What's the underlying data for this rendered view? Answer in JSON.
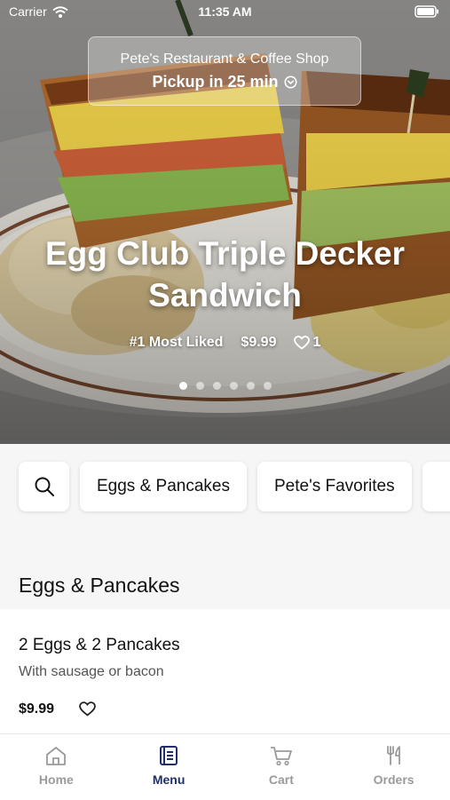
{
  "status_bar": {
    "carrier": "Carrier",
    "time": "11:35 AM"
  },
  "restaurant": {
    "name": "Pete's Restaurant & Coffee Shop",
    "pickup": "Pickup in 25 min"
  },
  "hero": {
    "title": "Egg Club Triple Decker Sandwich",
    "rank": "#1 Most Liked",
    "price": "$9.99",
    "likes": "1",
    "slide_count": 6,
    "active_slide": 1
  },
  "categories": {
    "search_icon": "search-icon",
    "items": [
      "Eggs & Pancakes",
      "Pete's Favorites"
    ]
  },
  "section": {
    "title": "Eggs & Pancakes",
    "items": [
      {
        "name": "2 Eggs & 2 Pancakes",
        "description": "With sausage or bacon",
        "price": "$9.99"
      }
    ]
  },
  "tab_bar": {
    "tabs": [
      {
        "label": "Home",
        "icon": "home-icon",
        "active": false
      },
      {
        "label": "Menu",
        "icon": "menu-book-icon",
        "active": true
      },
      {
        "label": "Cart",
        "icon": "cart-icon",
        "active": false
      },
      {
        "label": "Orders",
        "icon": "fork-knife-icon",
        "active": false
      }
    ]
  },
  "colors": {
    "accent": "#1f2f6b",
    "inactive_tab": "#9a9a9a",
    "background": "#f6f6f6"
  }
}
